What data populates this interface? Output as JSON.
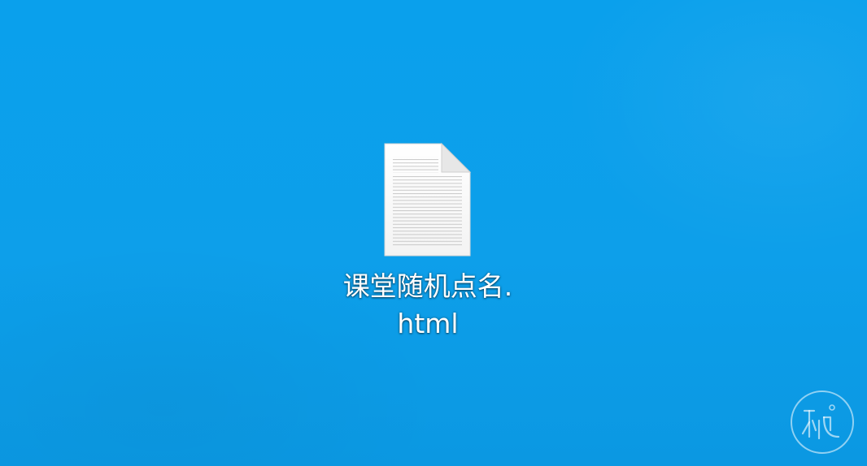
{
  "desktop": {
    "file": {
      "name_line1": "课堂随机点名.",
      "name_line2": "html",
      "icon": "text-document-icon"
    },
    "watermark": {
      "icon": "circular-logo-watermark"
    }
  }
}
